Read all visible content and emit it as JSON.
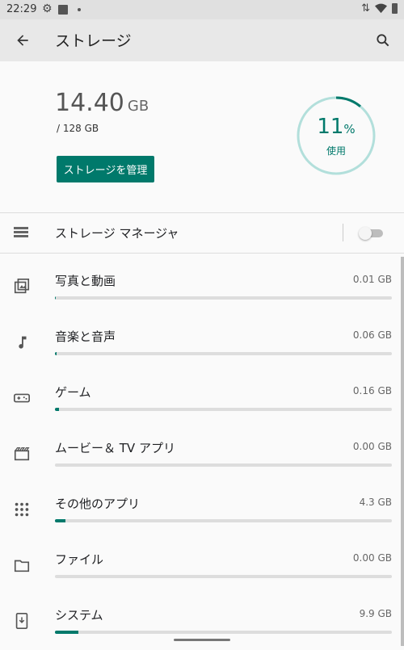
{
  "status_bar": {
    "time": "22:29"
  },
  "app_bar": {
    "title": "ストレージ"
  },
  "summary": {
    "used_value": "14.40",
    "used_unit": "GB",
    "total": "/ 128 GB",
    "percent": "11",
    "percent_sign": "%",
    "percent_fraction": 0.11,
    "used_label": "使用",
    "manage_button": "ストレージを管理",
    "accent_color": "#00796b"
  },
  "storage_manager": {
    "label": "ストレージ マネージャ",
    "enabled": false
  },
  "categories": [
    {
      "label": "写真と動画",
      "size": "0.01 GB",
      "fraction": 0.001,
      "icon": "photo-icon"
    },
    {
      "label": "音楽と音声",
      "size": "0.06 GB",
      "fraction": 0.004,
      "icon": "music-note-icon"
    },
    {
      "label": "ゲーム",
      "size": "0.16 GB",
      "fraction": 0.011,
      "icon": "gamepad-icon"
    },
    {
      "label": "ムービー＆ TV アプリ",
      "size": "0.00 GB",
      "fraction": 0.0,
      "icon": "movie-icon"
    },
    {
      "label": "その他のアプリ",
      "size": "4.3 GB",
      "fraction": 0.03,
      "icon": "apps-grid-icon"
    },
    {
      "label": "ファイル",
      "size": "0.00 GB",
      "fraction": 0.0,
      "icon": "folder-icon"
    },
    {
      "label": "システム",
      "size": "9.9 GB",
      "fraction": 0.07,
      "icon": "system-update-icon"
    }
  ]
}
